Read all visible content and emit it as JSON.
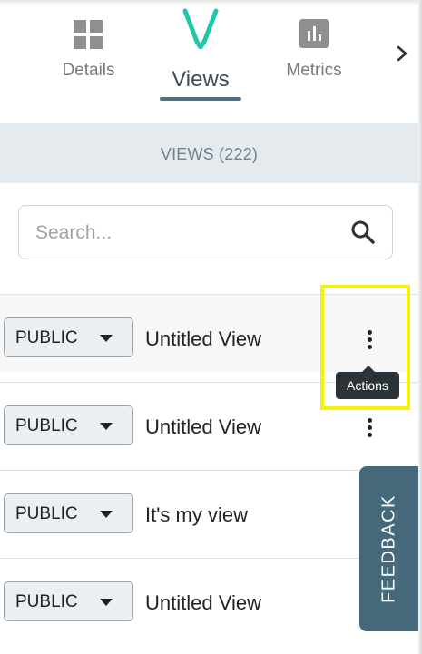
{
  "tabs": [
    {
      "label": "Details",
      "icon": "grid-icon"
    },
    {
      "label": "Views",
      "icon": "v-logo-icon",
      "active": true
    },
    {
      "label": "Metrics",
      "icon": "bar-chart-icon"
    }
  ],
  "section": {
    "title": "VIEWS (222)"
  },
  "search": {
    "placeholder": "Search..."
  },
  "views": [
    {
      "visibility": "PUBLIC",
      "name": "Untitled View"
    },
    {
      "visibility": "PUBLIC",
      "name": "Untitled View"
    },
    {
      "visibility": "PUBLIC",
      "name": "It's my view"
    },
    {
      "visibility": "PUBLIC",
      "name": "Untitled View"
    }
  ],
  "tooltip": {
    "label": "Actions"
  },
  "feedback": {
    "label": "FEEDBACK"
  },
  "colors": {
    "accent": "#1ec8a5",
    "header_bg": "#e5eaee",
    "feedback_bg": "#45687a",
    "highlight": "#f7f00e"
  }
}
